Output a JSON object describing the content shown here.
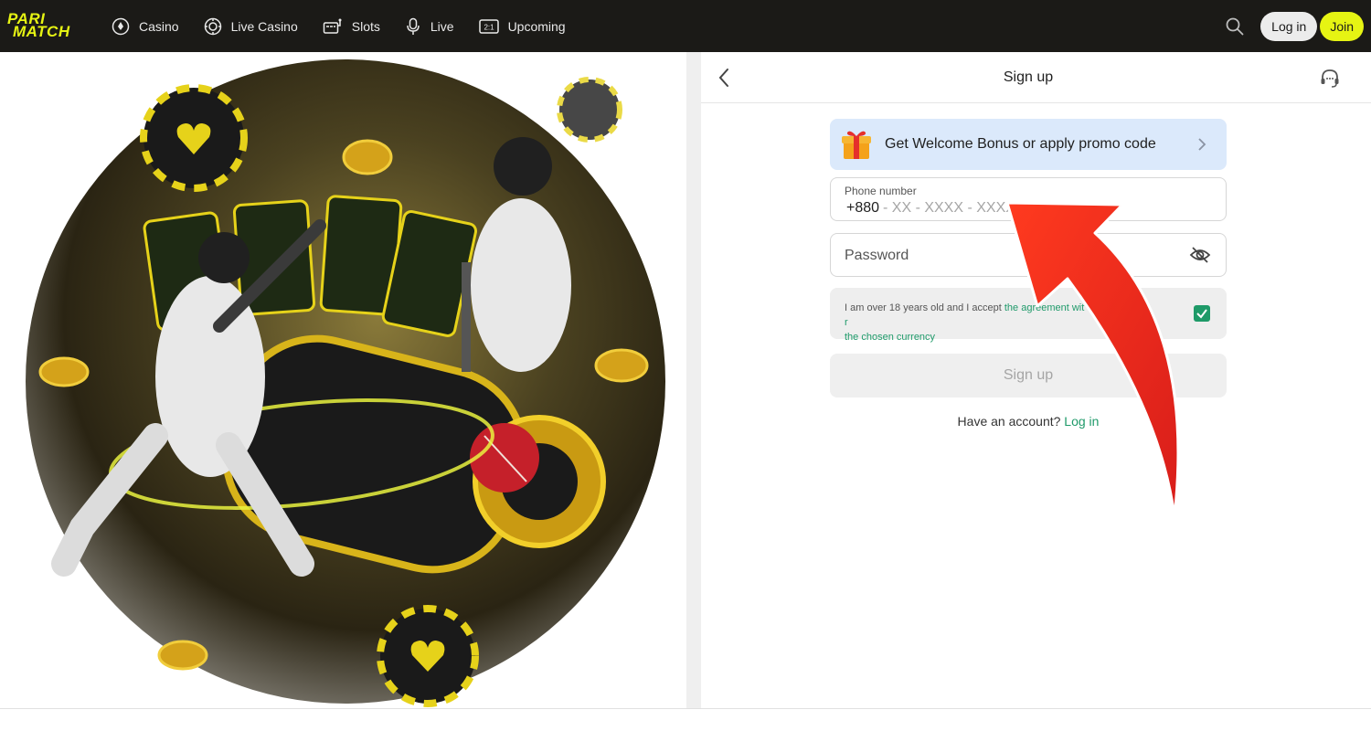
{
  "brand": {
    "logo_line1": "PARI",
    "logo_line2": "MATCH",
    "accent": "#e6f413"
  },
  "nav": {
    "items": [
      {
        "label": "Casino",
        "icon": "casino-icon"
      },
      {
        "label": "Live Casino",
        "icon": "chip-icon"
      },
      {
        "label": "Slots",
        "icon": "slot-icon"
      },
      {
        "label": "Live",
        "icon": "microphone-icon"
      },
      {
        "label": "Upcoming",
        "icon": "scoreboard-icon"
      }
    ],
    "scoreboard_text": "2:1"
  },
  "header_actions": {
    "login_label": "Log in",
    "join_label": "Join"
  },
  "form": {
    "title": "Sign up",
    "bonus_text": "Get Welcome Bonus or apply promo code",
    "phone_label": "Phone number",
    "phone_code": "+880",
    "phone_placeholder": "- XX - XXXX - XXXX",
    "password_placeholder": "Password",
    "consent_prefix": "I am over 18 years old and I accept ",
    "consent_link": "the agreement wit",
    "consent_link_tail": "r",
    "consent_link2": "the chosen currency",
    "consent_checked": true,
    "signup_label": "Sign up",
    "have_account_text": "Have an account?",
    "login_link": "Log in"
  },
  "colors": {
    "topbar": "#1b1a17",
    "link_green": "#1f9a6a",
    "bonus_bg": "#dbe9fb",
    "arrow_red": "#e8241b"
  }
}
